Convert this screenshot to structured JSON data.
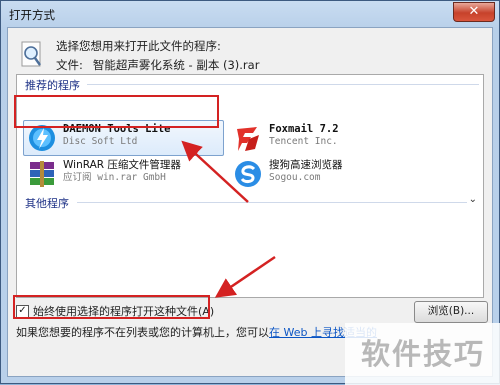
{
  "window": {
    "title": "打开方式",
    "close_glyph": "✕"
  },
  "header": {
    "prompt": "选择您想用来打开此文件的程序:",
    "file_label": "文件:",
    "file_name": "智能超声雾化系统 - 副本 (3).rar"
  },
  "groups": {
    "recommended": "推荐的程序",
    "other": "其他程序"
  },
  "apps": [
    {
      "name": "DAEMON Tools Lite",
      "publisher": "Disc Soft Ltd",
      "icon": "daemon-tools-icon",
      "selected": true
    },
    {
      "name": "Foxmail 7.2",
      "publisher": "Tencent Inc.",
      "icon": "foxmail-icon",
      "selected": false
    },
    {
      "name": "WinRAR 压缩文件管理器",
      "publisher": "应订阅 win.rar GmbH",
      "icon": "winrar-icon",
      "selected": false
    },
    {
      "name": "搜狗高速浏览器",
      "publisher": "Sogou.com",
      "icon": "sogou-browser-icon",
      "selected": false
    }
  ],
  "checkbox": {
    "label": "始终使用选择的程序打开这种文件(A)",
    "checked": true,
    "mark": "✓"
  },
  "buttons": {
    "browse": "浏览(B)..."
  },
  "footer": {
    "text": "如果您想要的程序不在列表或您的计算机上，您可以",
    "link": "在 Web 上寻找适当的"
  },
  "watermark": "软件技巧",
  "colors": {
    "annotation_red": "#d42222",
    "link_blue": "#0b55c4",
    "group_header": "#1e3287"
  }
}
